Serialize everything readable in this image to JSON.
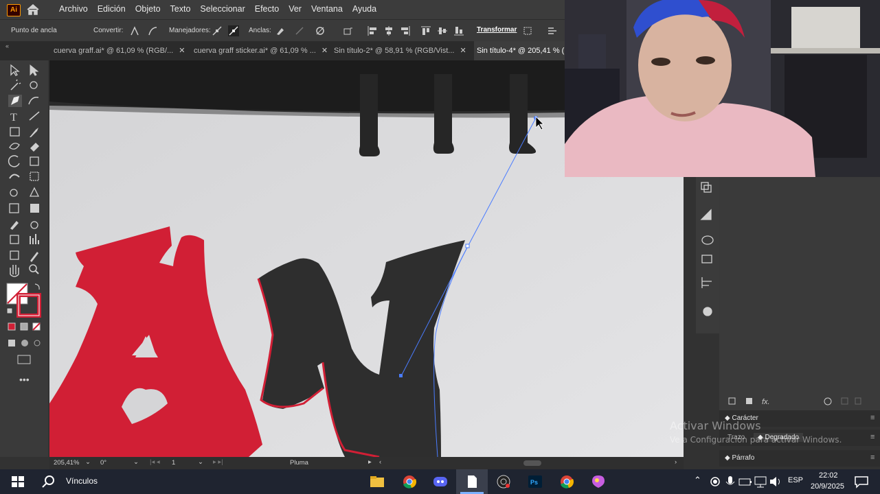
{
  "app": {
    "logo_text": "Ai",
    "menus": [
      "Archivo",
      "Edición",
      "Objeto",
      "Texto",
      "Seleccionar",
      "Efecto",
      "Ver",
      "Ventana",
      "Ayuda"
    ]
  },
  "control_bar": {
    "anchor_label": "Punto de ancla",
    "convert_label": "Convertir:",
    "handles_label": "Manejadores:",
    "anchors_label": "Anclas:",
    "transform_label": "Transformar"
  },
  "tabs": [
    {
      "label": "cuerva graff.ai* @ 61,09 % (RGB/..."
    },
    {
      "label": "cuerva graff sticker.ai* @ 61,09 % ..."
    },
    {
      "label": "Sin título-2* @ 58,91 % (RGB/Vist..."
    },
    {
      "label": "Sin título-4* @ 205,41 % ("
    }
  ],
  "status_bar": {
    "zoom": "205,41%",
    "rotation": "0°",
    "artboard": "1",
    "tool_name": "Pluma"
  },
  "panels": {
    "character": "Carácter",
    "stroke": "Trazo",
    "gradient": "Degradado",
    "paragraph": "Párrafo"
  },
  "watermark": {
    "line1": "Activar Windows",
    "line2": "Ve a Configuración para activar Windows."
  },
  "taskbar": {
    "search_label": "Vínculos",
    "language": "ESP",
    "time": "22:02",
    "date": "20/9/2025"
  },
  "colors": {
    "fill_red": "#d11f35",
    "accent": "#4a7cff"
  }
}
